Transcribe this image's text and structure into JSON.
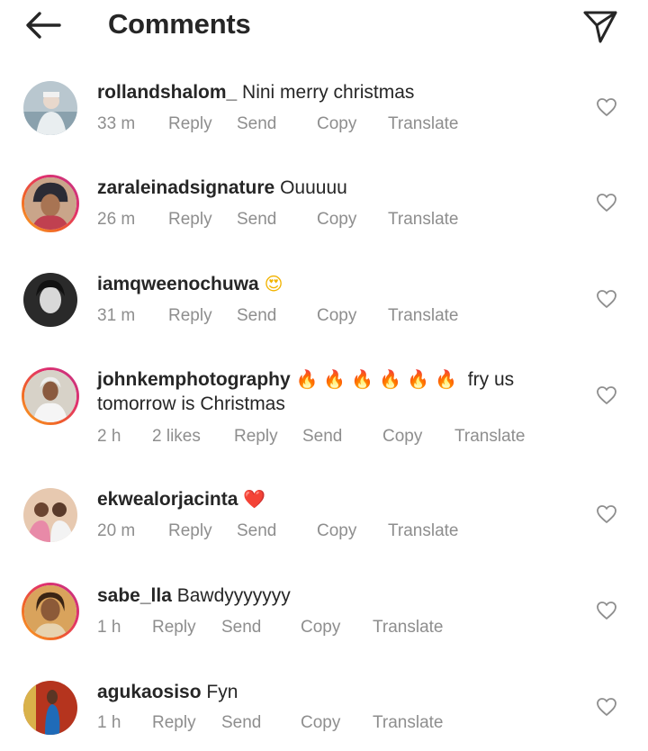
{
  "header": {
    "title": "Comments",
    "back_icon": "arrow-left-icon",
    "share_icon": "paper-plane-icon"
  },
  "actions": {
    "reply": "Reply",
    "send": "Send",
    "copy": "Copy",
    "translate": "Translate"
  },
  "comments": [
    {
      "username": "rollandshalom_",
      "text": "Nini merry christmas",
      "time": "33 m"
    },
    {
      "username": "zaraleinadsignature",
      "text": "Ouuuuu",
      "time": "26 m"
    },
    {
      "username": "iamqweenochuwa",
      "text": "😍",
      "time": "31 m"
    },
    {
      "username": "johnkemphotography",
      "emoji": "🔥🔥🔥🔥🔥🔥",
      "text": "fry us",
      "text_line2": "tomorrow is Christmas",
      "time": "2 h",
      "likes": "2 likes"
    },
    {
      "username": "ekwealorjacinta",
      "text": "❤️",
      "time": "20 m"
    },
    {
      "username": "sabe_lla",
      "text": "Bawdyyyyyyy",
      "time": "1 h"
    },
    {
      "username": "agukaosiso",
      "text": "Fyn",
      "time": "1 h"
    }
  ],
  "colors": {
    "text": "#262626",
    "meta": "#8e8e8e",
    "story_ring_start": "#f9a825",
    "story_ring_end": "#c13584"
  }
}
